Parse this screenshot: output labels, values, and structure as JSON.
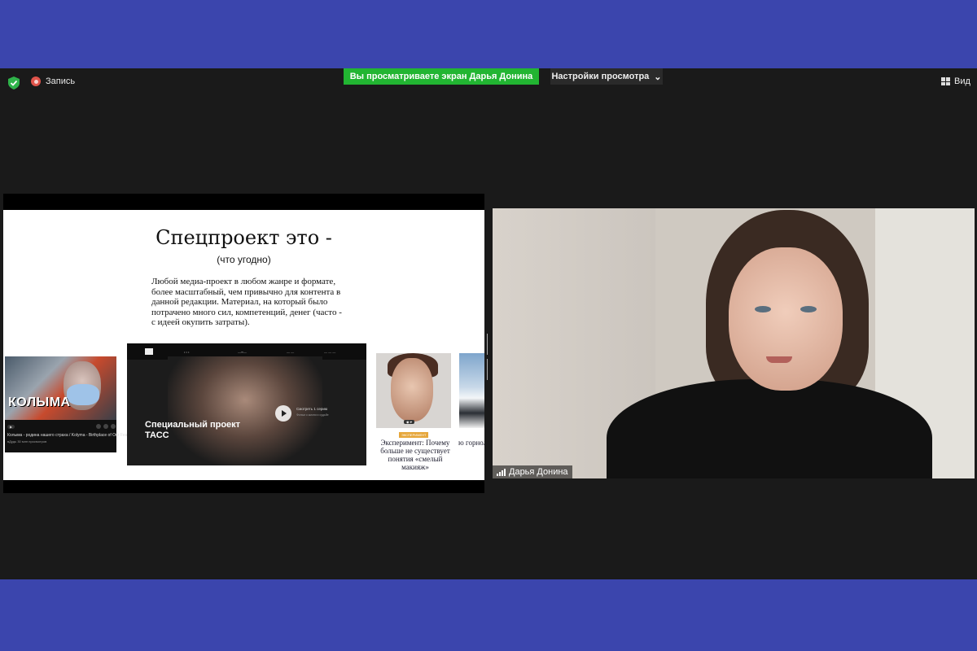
{
  "colors": {
    "frame": "#3b45ad",
    "zoom_bg": "#1a1a1a",
    "banner": "#22b532",
    "record": "#e0544b"
  },
  "topbar": {
    "record_label": "Запись",
    "share_banner": "Вы просматриваете экран Дарья Донина",
    "view_options": "Настройки просмотра",
    "view_button": "Вид"
  },
  "slide": {
    "title": "Спецпроект это -",
    "subtitle": "(что угодно)",
    "body": "Любой медиа-проект в любом жанре и формате, более масштабный, чем привычно для контента в данной редакции. Материал, на который было потрачено много сил, компетенций, денег (часто - с идеей окупить затраты).",
    "kolyma": {
      "word": "КОЛЫМА",
      "title": "Колыма - родина нашего страха / Kolyma - Birthplace of Our Fear",
      "meta": "вДудь   30 млн просмотров"
    },
    "tass": {
      "label_line1": "Специальный проект",
      "label_line2": "ТАСС",
      "watch": "Смотреть 1 серию",
      "watch_sub": "Фильм о жизни и судьбе"
    },
    "beauty": {
      "tag": "ЭКСПЕРИМЕНТ",
      "text": "Эксперимент: Почему больше не существует понятия «смелый макияж»"
    },
    "snow_text": "ю горнол которые по повседнев"
  },
  "camera": {
    "participant_name": "Дарья Донина"
  }
}
